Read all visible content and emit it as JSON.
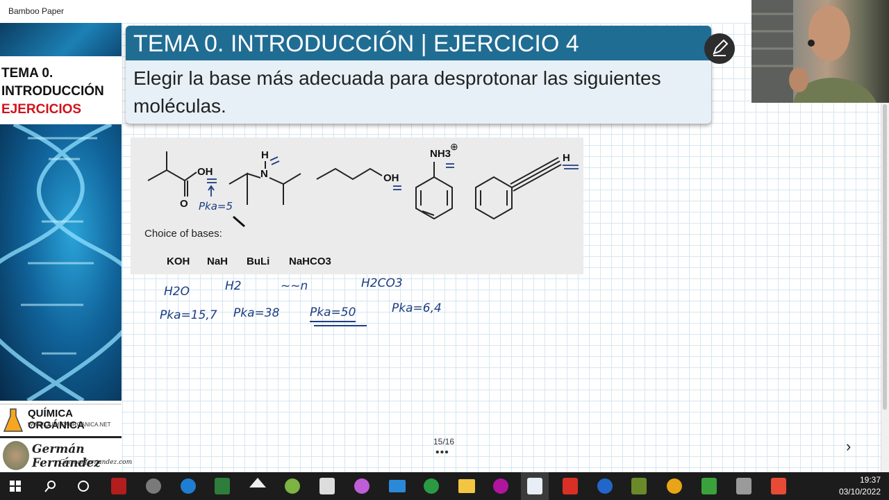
{
  "window": {
    "title": "Bamboo Paper"
  },
  "sidebar": {
    "title_line1": "TEMA 0.",
    "title_line2": "INTRODUCCIÓN",
    "title_line3": "EJERCICIOS",
    "logo1_title": "QUÍMICA ORGÁNICA",
    "logo1_url": "WWW.QUIMICAORGANICA.NET",
    "logo2_name": "Germán Fernández",
    "logo2_url": "Germanfernandez.com"
  },
  "slide": {
    "header": "TEMA 0. INTRODUCCIÓN | EJERCICIO 4",
    "body": "Elegir la base más adecuada para desprotonar las siguientes moléculas."
  },
  "chem": {
    "choice_label": "Choice of bases:",
    "bases": [
      "KOH",
      "NaH",
      "BuLi",
      "NaHCO3"
    ],
    "atoms": {
      "oh1": "OH",
      "o": "O",
      "h": "H",
      "n": "N",
      "oh2": "OH",
      "nh3": "NH3",
      "h2": "H"
    },
    "annotation": "Pka=5"
  },
  "handwriting": {
    "species": [
      "H2O",
      "H2",
      "~~n",
      "H2CO3"
    ],
    "pkas": [
      "Pka=15,7",
      "Pka=38",
      "Pka=50",
      "Pka=6,4"
    ]
  },
  "pager": {
    "page": "15/16",
    "dots": "•••"
  },
  "colors": {
    "header_bg": "#206d94",
    "card_bg": "#e7f0f6",
    "grid": "#d6e6f1",
    "ink": "#1c3d82",
    "taskbar": "#1c1c1c"
  },
  "taskbar": {
    "icons": [
      "windows-start-icon",
      "search-icon",
      "cortana-icon",
      "filezilla-icon",
      "media-player-icon",
      "stack-icon",
      "excel-icon",
      "inkscape-icon",
      "android-icon",
      "color-picker-icon",
      "mail-icon",
      "cd-icon",
      "file-explorer-icon",
      "3d-icon",
      "bamboo-paper-icon",
      "pdf-icon",
      "sync-icon",
      "texstudio-icon",
      "chrome-icon",
      "camtasia-icon",
      "terminal-icon",
      "recorder-icon"
    ],
    "time": "19:37",
    "date": "03/10/2022"
  }
}
